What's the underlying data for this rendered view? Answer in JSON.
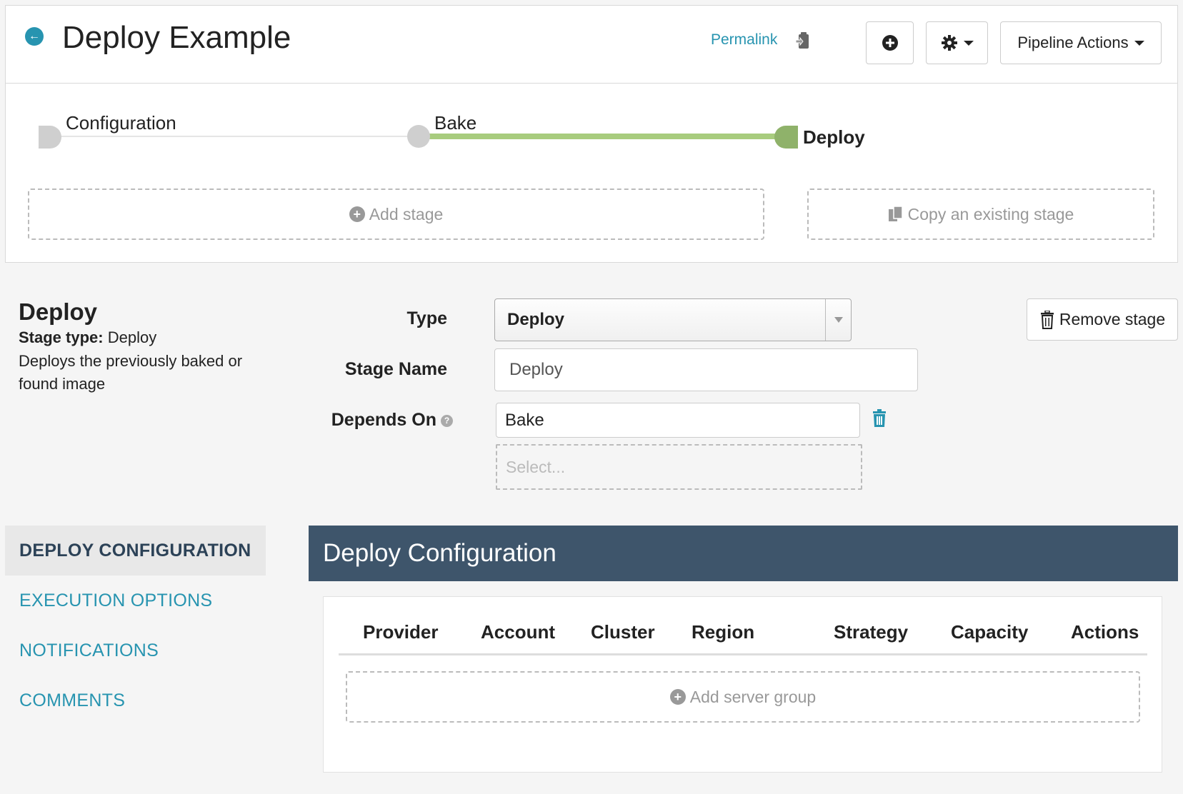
{
  "header": {
    "title": "Deploy Example",
    "permalink_label": "Permalink",
    "pipeline_actions_label": "Pipeline Actions"
  },
  "pipeline_graph": {
    "nodes": [
      {
        "label": "Configuration",
        "active": false
      },
      {
        "label": "Bake",
        "active": false
      },
      {
        "label": "Deploy",
        "active": true
      }
    ],
    "add_stage_label": "Add stage",
    "copy_stage_label": "Copy an existing stage",
    "colors": {
      "active_edge": "#a8cc7e",
      "active_node": "#8fb26a",
      "node": "#cfcfcf"
    }
  },
  "stage": {
    "title": "Deploy",
    "type_prefix": "Stage type:",
    "type_value": "Deploy",
    "description": "Deploys the previously baked or found image",
    "remove_label": "Remove stage",
    "form": {
      "type_label": "Type",
      "type_value": "Deploy",
      "stage_name_label": "Stage Name",
      "stage_name_value": "Deploy",
      "depends_on_label": "Depends On",
      "depends_on_value": "Bake",
      "depends_on_placeholder": "Select..."
    }
  },
  "nav": {
    "items": [
      {
        "label": "DEPLOY CONFIGURATION",
        "active": true
      },
      {
        "label": "EXECUTION OPTIONS",
        "active": false
      },
      {
        "label": "NOTIFICATIONS",
        "active": false
      },
      {
        "label": "COMMENTS",
        "active": false
      }
    ]
  },
  "deploy_config": {
    "title": "Deploy Configuration",
    "columns": [
      "Provider",
      "Account",
      "Cluster",
      "Region",
      "Strategy",
      "Capacity",
      "Actions"
    ],
    "add_server_group_label": "Add server group"
  }
}
